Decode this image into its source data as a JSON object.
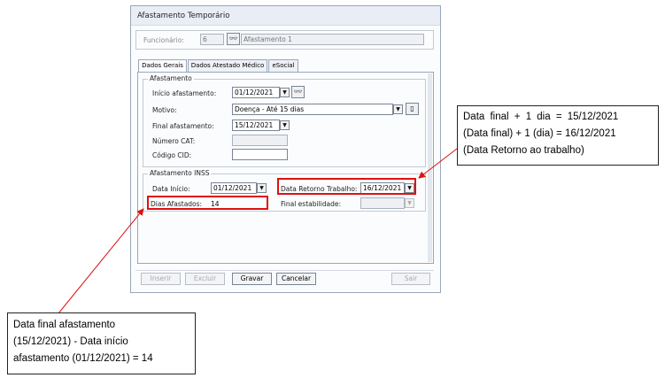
{
  "window": {
    "title": "Afastamento Temporário"
  },
  "header": {
    "funcionario_label": "Funcionário:",
    "funcionario_id": "6",
    "funcionario_name": "Afastamento 1"
  },
  "tabs": [
    {
      "label": "Dados Gerais",
      "active": true
    },
    {
      "label": "Dados Atestado Médico",
      "active": false
    },
    {
      "label": "eSocial",
      "active": false
    }
  ],
  "afastamento": {
    "group_title": "Afastamento",
    "inicio_label": "Início afastamento:",
    "inicio_value": "01/12/2021",
    "motivo_label": "Motivo:",
    "motivo_value": "Doença - Até 15 dias",
    "final_label": "Final afastamento:",
    "final_value": "15/12/2021",
    "cat_label": "Número CAT:",
    "cat_value": "",
    "cid_label": "Código CID:",
    "cid_value": ""
  },
  "inss": {
    "group_title": "Afastamento INSS",
    "data_inicio_label": "Data Início:",
    "data_inicio_value": "01/12/2021",
    "retorno_label": "Data Retorno Trabalho:",
    "retorno_value": "16/12/2021",
    "dias_label": "Dias Afastados:",
    "dias_value": "14",
    "estabilidade_label": "Final estabilidade:",
    "estabilidade_value": ""
  },
  "buttons": {
    "inserir": "Inserir",
    "excluir": "Excluir",
    "gravar": "Gravar",
    "cancelar": "Cancelar",
    "sair": "Sair"
  },
  "annotations": {
    "right": [
      "Data final + 1 dia = 15/12/2021",
      "(Data final) + 1 (dia) = 16/12/2021",
      "(Data Retorno ao trabalho)"
    ],
    "left": [
      "Data final afastamento",
      "(15/12/2021) - Data início",
      "afastamento (01/12/2021) = 14"
    ]
  },
  "colors": {
    "highlight": "#e01010",
    "window_bg": "#fbfcfe",
    "titlebar": "#e9eef6"
  },
  "icons": [
    "binoculars-icon",
    "chevron-down-icon",
    "page-icon"
  ]
}
